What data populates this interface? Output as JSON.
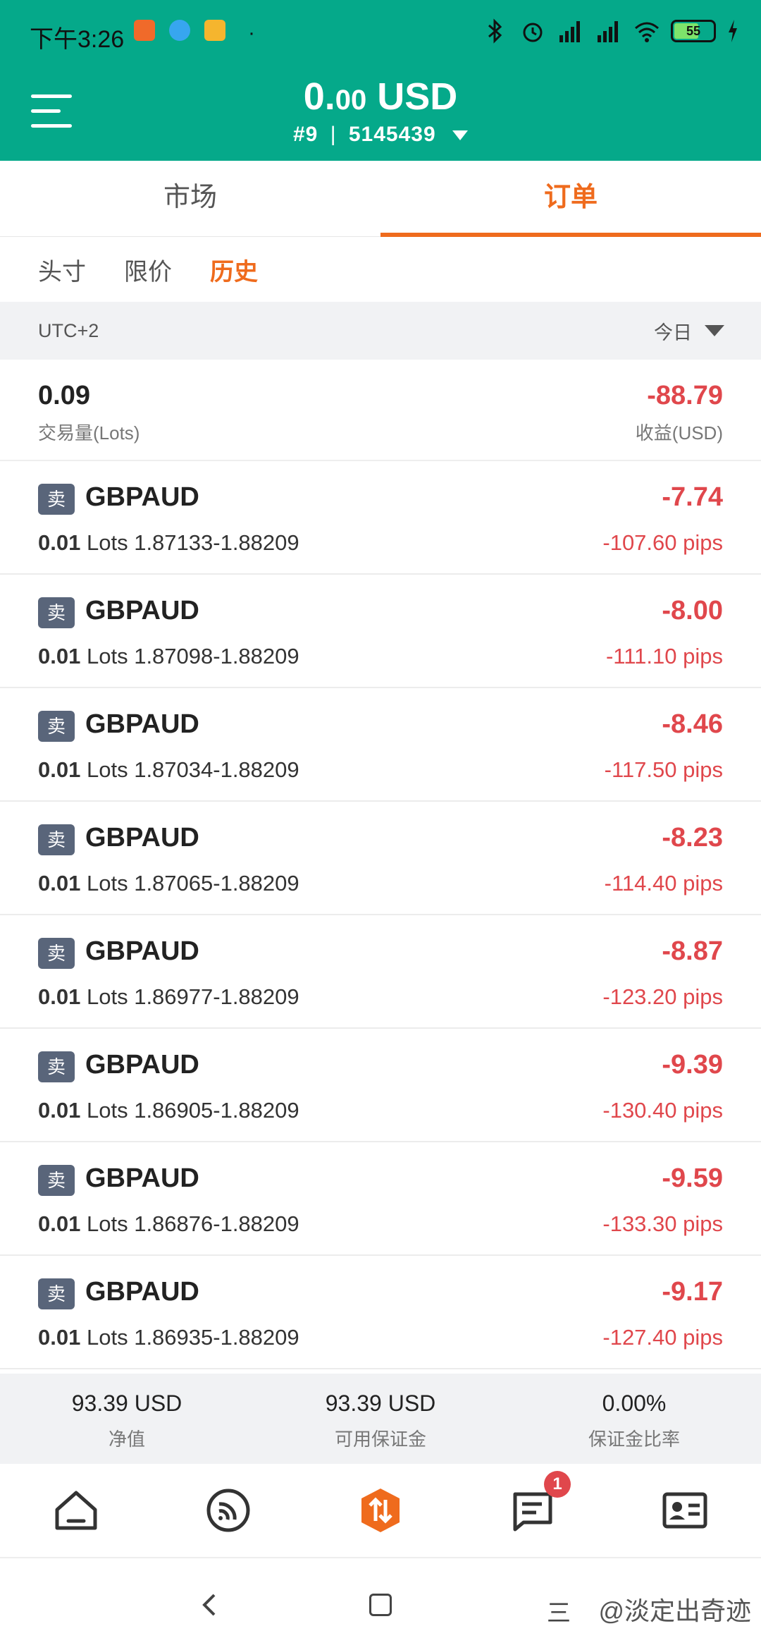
{
  "status_bar": {
    "time": "下午3:26",
    "dot": "·",
    "battery": "55",
    "app_colors": [
      "#f06a2a",
      "#37a6ef",
      "#f5b52e"
    ]
  },
  "header": {
    "balance_int": "0.",
    "balance_dec": "00",
    "balance_currency": " USD",
    "account_number": "#9",
    "separator": "|",
    "account_id": "5145439"
  },
  "tabs": [
    {
      "label": "市场"
    },
    {
      "label": "订单"
    }
  ],
  "subtabs": [
    {
      "label": "头寸"
    },
    {
      "label": "限价"
    },
    {
      "label": "历史"
    }
  ],
  "filter": {
    "timezone": "UTC+2",
    "period": "今日"
  },
  "summary": {
    "volume_value": "0.09",
    "volume_label": "交易量(Lots)",
    "profit_value": "-88.79",
    "profit_label": "收益(USD)"
  },
  "orders": [
    {
      "side": "卖",
      "symbol": "GBPAUD",
      "lots": "0.01",
      "lots_unit": "Lots",
      "prices": "1.87133-1.88209",
      "profit": "-7.74",
      "pips": "-107.60 pips"
    },
    {
      "side": "卖",
      "symbol": "GBPAUD",
      "lots": "0.01",
      "lots_unit": "Lots",
      "prices": "1.87098-1.88209",
      "profit": "-8.00",
      "pips": "-111.10 pips"
    },
    {
      "side": "卖",
      "symbol": "GBPAUD",
      "lots": "0.01",
      "lots_unit": "Lots",
      "prices": "1.87034-1.88209",
      "profit": "-8.46",
      "pips": "-117.50 pips"
    },
    {
      "side": "卖",
      "symbol": "GBPAUD",
      "lots": "0.01",
      "lots_unit": "Lots",
      "prices": "1.87065-1.88209",
      "profit": "-8.23",
      "pips": "-114.40 pips"
    },
    {
      "side": "卖",
      "symbol": "GBPAUD",
      "lots": "0.01",
      "lots_unit": "Lots",
      "prices": "1.86977-1.88209",
      "profit": "-8.87",
      "pips": "-123.20 pips"
    },
    {
      "side": "卖",
      "symbol": "GBPAUD",
      "lots": "0.01",
      "lots_unit": "Lots",
      "prices": "1.86905-1.88209",
      "profit": "-9.39",
      "pips": "-130.40 pips"
    },
    {
      "side": "卖",
      "symbol": "GBPAUD",
      "lots": "0.01",
      "lots_unit": "Lots",
      "prices": "1.86876-1.88209",
      "profit": "-9.59",
      "pips": "-133.30 pips"
    },
    {
      "side": "卖",
      "symbol": "GBPAUD",
      "lots": "0.01",
      "lots_unit": "Lots",
      "prices": "1.86935-1.88209",
      "profit": "-9.17",
      "pips": "-127.40 pips"
    }
  ],
  "footer_stats": [
    {
      "value": "93.39 USD",
      "label": "净值"
    },
    {
      "value": "93.39 USD",
      "label": "可用保证金"
    },
    {
      "value": "0.00%",
      "label": "保证金比率"
    }
  ],
  "bottom_nav": [
    {
      "icon": "home-icon"
    },
    {
      "icon": "signal-icon"
    },
    {
      "icon": "trade-icon"
    },
    {
      "icon": "message-icon",
      "badge": "1"
    },
    {
      "icon": "profile-card-icon"
    }
  ],
  "system_nav": {
    "recent_glyph": "三",
    "watermark": "@淡定出奇迹"
  },
  "colors": {
    "brand": "#05a98a",
    "accent": "#ef6b1d",
    "loss": "#e0474c",
    "badge": "#59657a"
  }
}
